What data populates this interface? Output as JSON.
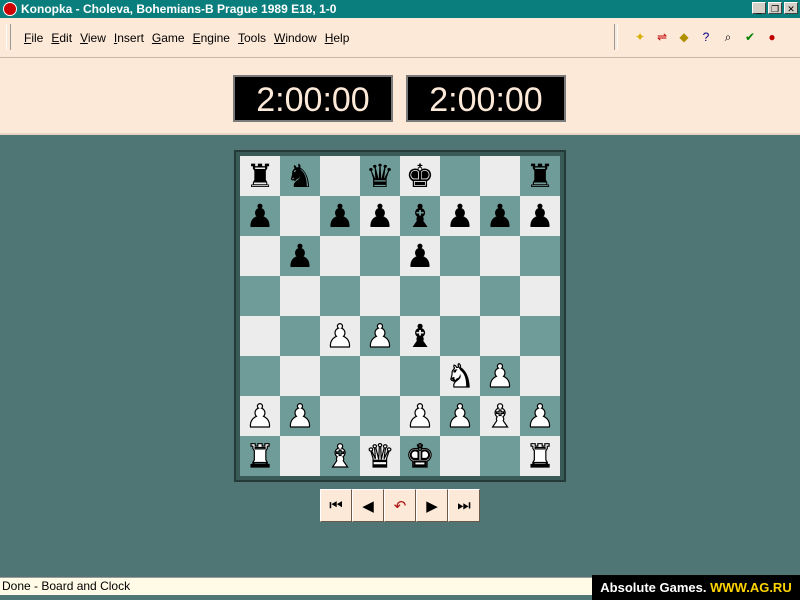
{
  "window": {
    "title": "Konopka - Choleva, Bohemians-B Prague 1989  E18, 1-0",
    "controls": [
      "_",
      "❐",
      "✕"
    ]
  },
  "menu": {
    "items": [
      "File",
      "Edit",
      "View",
      "Insert",
      "Game",
      "Engine",
      "Tools",
      "Window",
      "Help"
    ]
  },
  "toolbar": {
    "icons": [
      {
        "name": "new-game-icon",
        "glyph": "✦",
        "color": "#d8b000"
      },
      {
        "name": "flip-board-icon",
        "glyph": "⇌",
        "color": "#c00000"
      },
      {
        "name": "hint-icon",
        "glyph": "◆",
        "color": "#b09000"
      },
      {
        "name": "help-icon",
        "glyph": "?",
        "color": "#000080"
      },
      {
        "name": "analyze-icon",
        "glyph": "⌕",
        "color": "#000000"
      },
      {
        "name": "ok-icon",
        "glyph": "✔",
        "color": "#008000"
      },
      {
        "name": "stop-icon",
        "glyph": "●",
        "color": "#c00000"
      }
    ]
  },
  "clocks": {
    "white": "2:00:00",
    "black": "2:00:00"
  },
  "board": {
    "colors": {
      "light": "#ececec",
      "dark": "#6f9b99"
    },
    "rows": [
      [
        "r",
        "n",
        "",
        "q",
        "k",
        "",
        "",
        "r"
      ],
      [
        "p",
        "",
        "p",
        "p",
        "b",
        "p",
        "p",
        "p"
      ],
      [
        "",
        "p",
        "",
        "",
        "p",
        "",
        "",
        ""
      ],
      [
        "",
        "",
        "",
        "",
        "",
        "",
        "",
        ""
      ],
      [
        "",
        "",
        "P",
        "P",
        "b",
        "",
        "",
        ""
      ],
      [
        "",
        "",
        "",
        "",
        "",
        "N",
        "P",
        ""
      ],
      [
        "P",
        "P",
        "",
        "",
        "P",
        "P",
        "B",
        "P"
      ],
      [
        "R",
        "",
        "B",
        "Q",
        "K",
        "",
        "",
        "R"
      ]
    ]
  },
  "navigation": {
    "buttons": [
      {
        "name": "first-move-button",
        "glyph": "⏮"
      },
      {
        "name": "previous-move-button",
        "glyph": "◀"
      },
      {
        "name": "takeback-button",
        "glyph": "↶"
      },
      {
        "name": "next-move-button",
        "glyph": "▶"
      },
      {
        "name": "last-move-button",
        "glyph": "⏭"
      }
    ]
  },
  "status": {
    "text": "Done - Board and Clock"
  },
  "watermark": {
    "brand": "Absolute Games.",
    "url": "WWW.AG.RU"
  }
}
